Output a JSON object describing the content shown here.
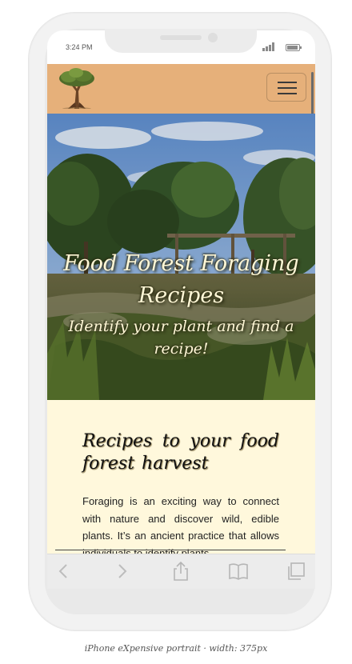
{
  "status_bar": {
    "time": "3:24 PM"
  },
  "nav": {
    "logo_icon": "tree-logo-icon",
    "menu_icon": "hamburger-menu-icon",
    "background_color": "#e6b07a"
  },
  "hero": {
    "title": "Food Forest Foraging Recipes",
    "subtitle": "Identify your plant and find a recipe!"
  },
  "intro": {
    "heading": "Recipes to your food forest harvest",
    "text": "Foraging is an exciting way to connect with nature and discover wild, edible plants. It’s an ancient practice that allows individuals to identify plants"
  },
  "browser_toolbar": {
    "icons": [
      "back-icon",
      "forward-icon",
      "share-icon",
      "bookmarks-icon",
      "tabs-icon"
    ]
  },
  "caption": "iPhone eXpensive portrait · width: 375px"
}
